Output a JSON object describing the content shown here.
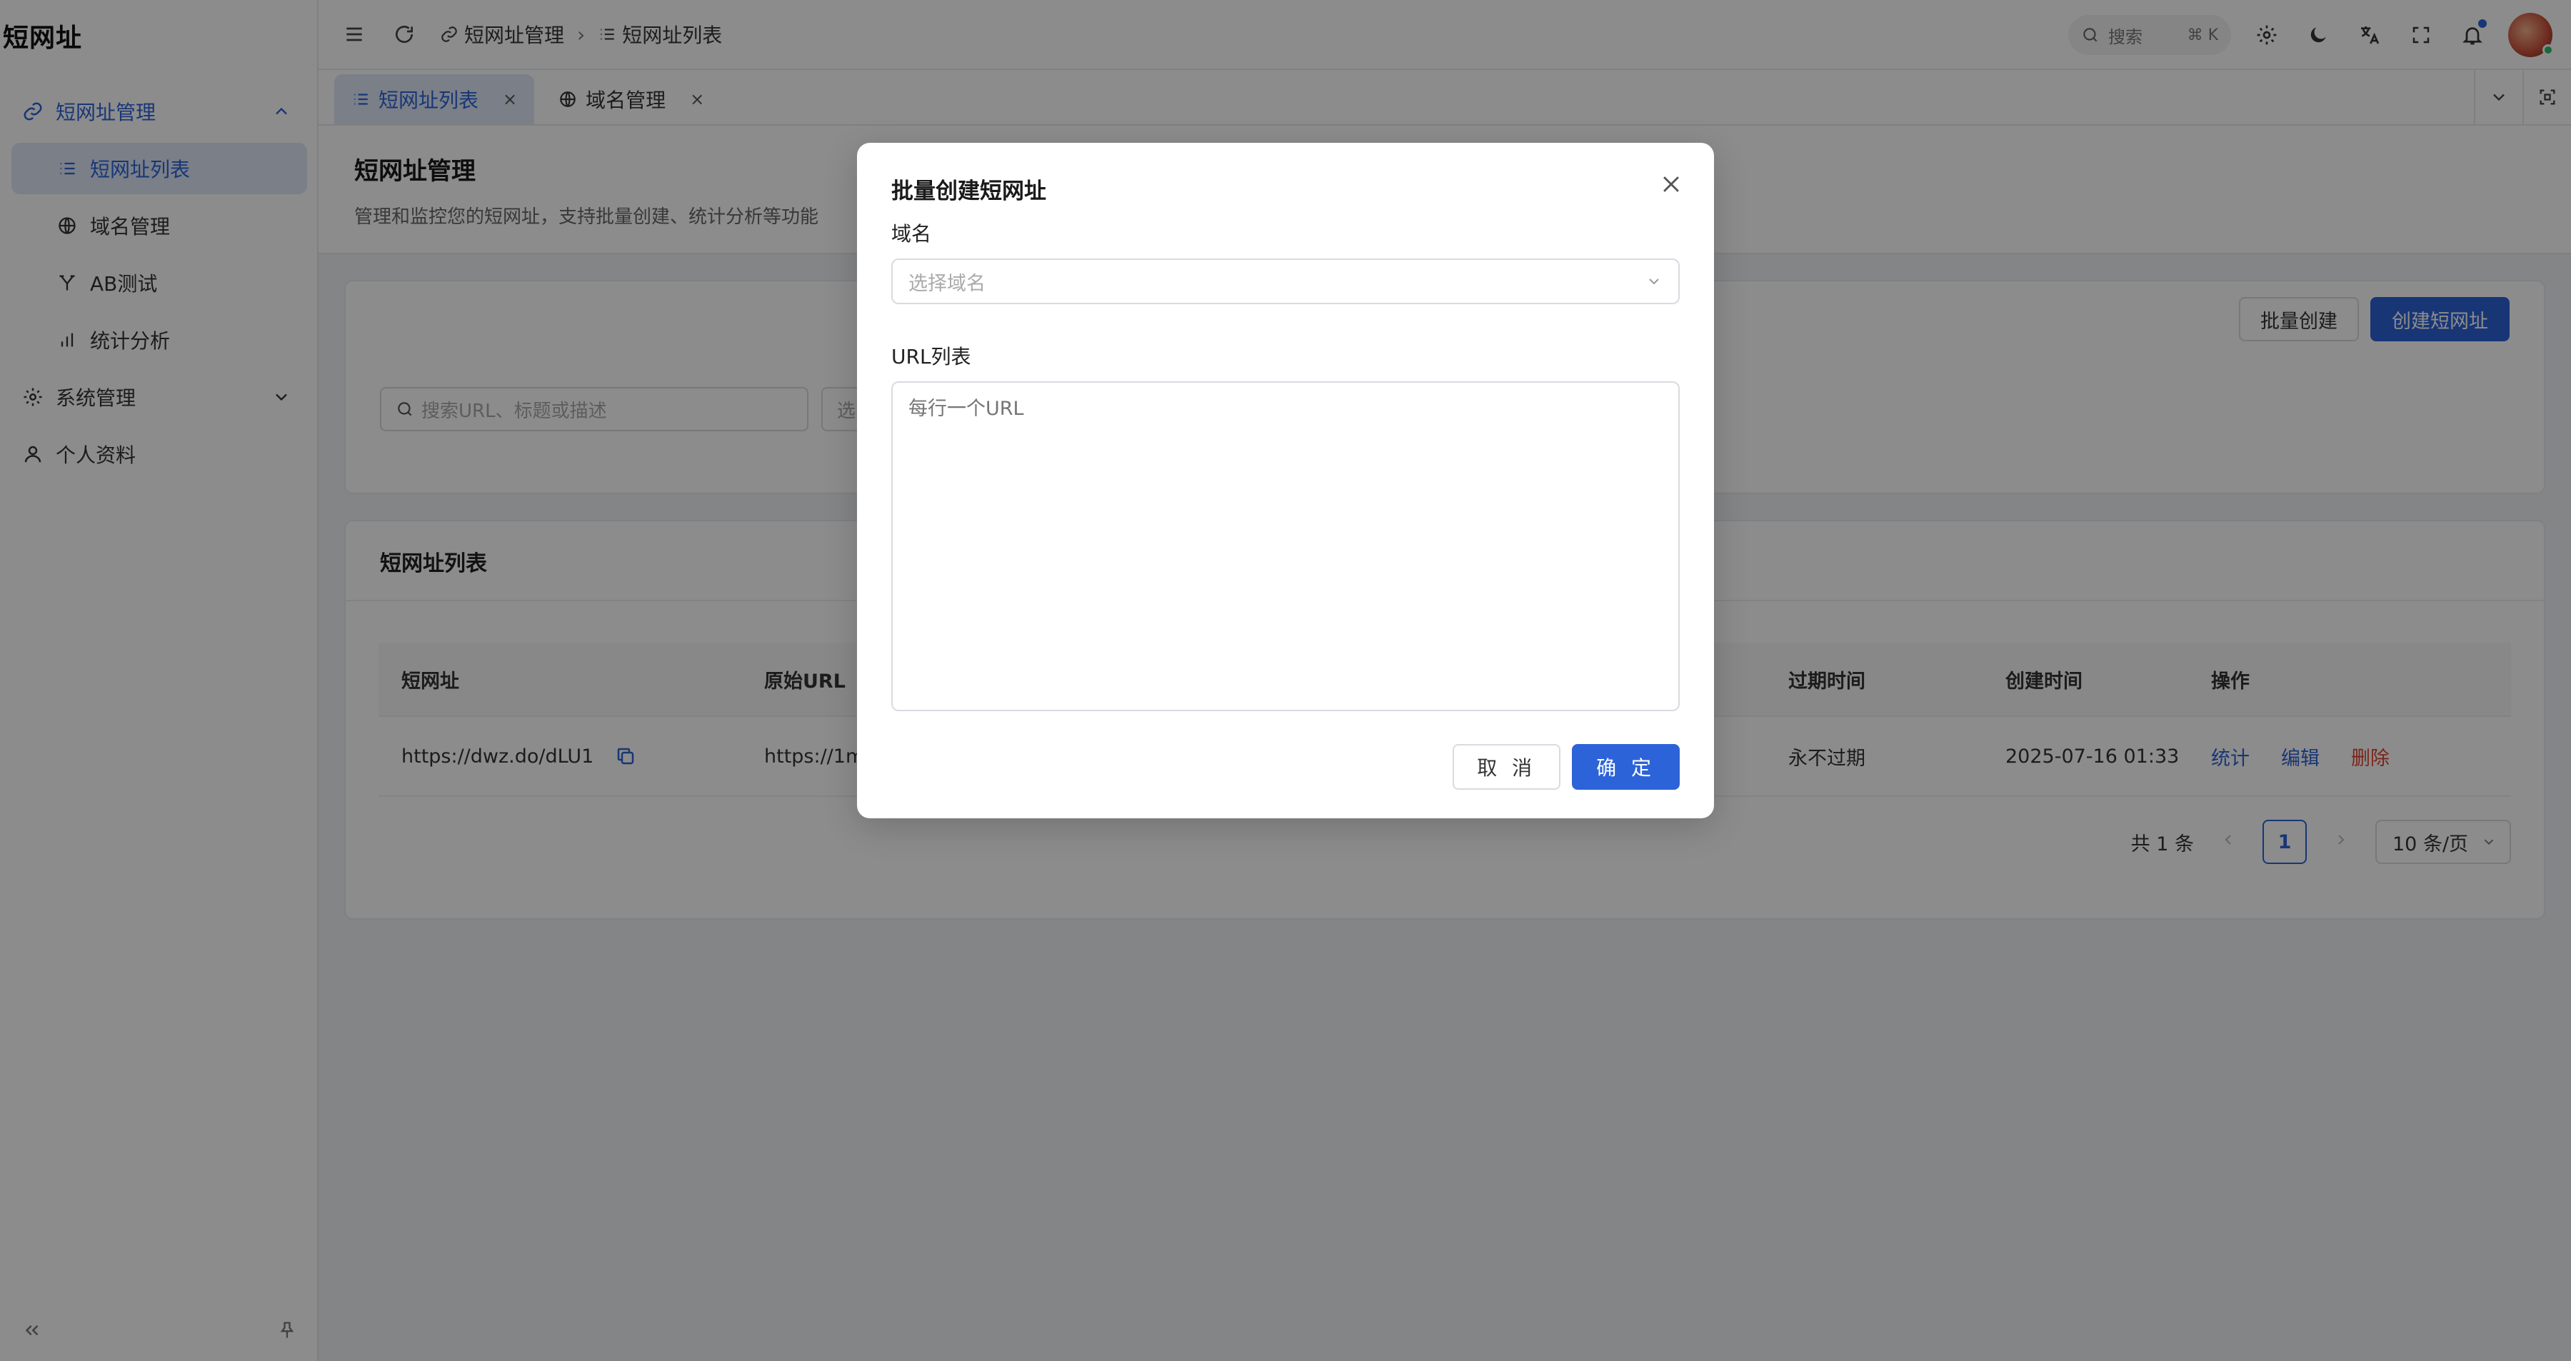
{
  "app": {
    "brand": "短网址"
  },
  "sidebar": {
    "groups": [
      {
        "label": "短网址管理",
        "children": [
          "短网址列表",
          "域名管理",
          "AB测试",
          "统计分析"
        ]
      },
      {
        "label": "系统管理"
      },
      {
        "label": "个人资料"
      }
    ]
  },
  "header": {
    "breadcrumb": [
      "短网址管理",
      "短网址列表"
    ],
    "search_label": "搜索",
    "search_kbd": "⌘ K"
  },
  "tabs": [
    {
      "label": "短网址列表",
      "close": "×"
    },
    {
      "label": "域名管理",
      "close": "×"
    }
  ],
  "page": {
    "title": "短网址管理",
    "description": "管理和监控您的短网址，支持批量创建、统计分析等功能"
  },
  "filters": {
    "search_placeholder": "搜索URL、标题或描述",
    "select_placeholder": "选",
    "batch_create": "批量创建",
    "create": "创建短网址"
  },
  "list": {
    "title": "短网址列表",
    "columns": [
      "短网址",
      "原始URL",
      "过期时间",
      "创建时间",
      "操作"
    ],
    "rows": [
      {
        "short": "https://dwz.do/dLU1",
        "original": "https://1m",
        "expire": "永不过期",
        "created": "2025-07-16 01:33"
      }
    ],
    "actions": [
      "统计",
      "编辑",
      "删除"
    ],
    "pager": {
      "total": "共 1 条",
      "current": "1",
      "size": "10 条/页"
    }
  },
  "modal": {
    "title": "批量创建短网址",
    "domain_label": "域名",
    "domain_placeholder": "选择域名",
    "urls_label": "URL列表",
    "urls_placeholder": "每行一个URL",
    "cancel": "取 消",
    "ok": "确 定"
  },
  "colors": {
    "primary": "#2d63d8",
    "danger": "#e0442e",
    "active_bg": "#dfe7f7"
  }
}
